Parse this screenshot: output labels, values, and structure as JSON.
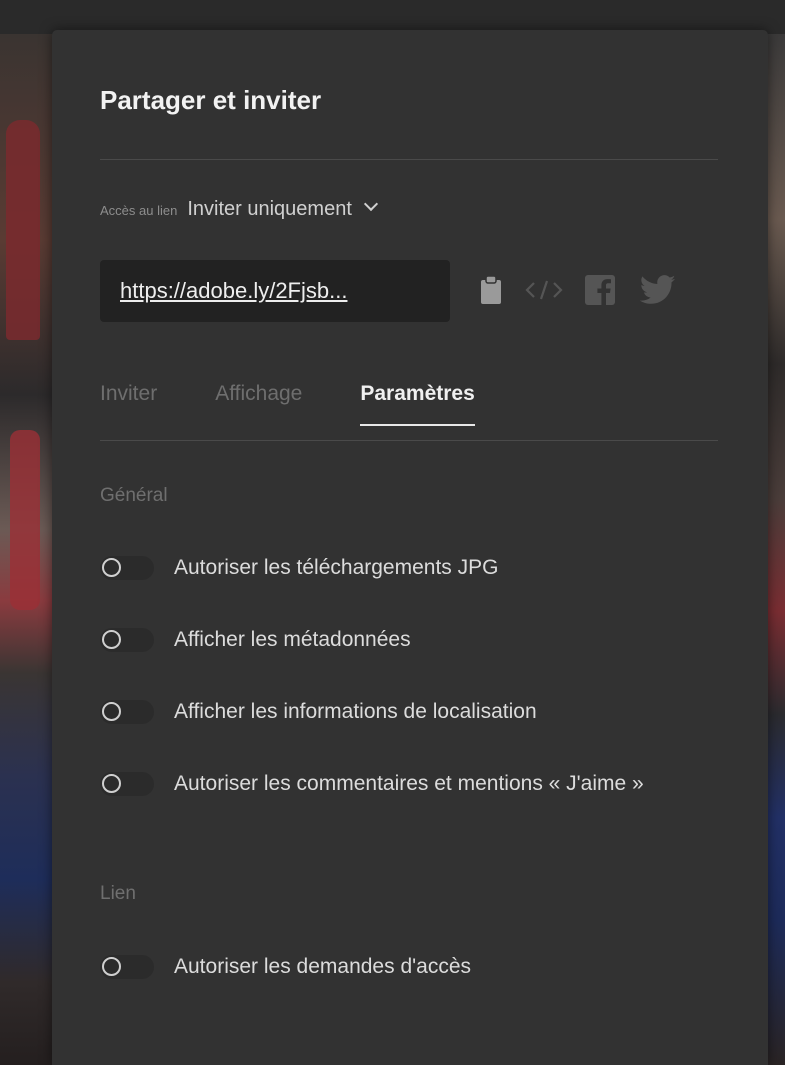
{
  "dialog": {
    "title": "Partager et inviter",
    "link_access_label": "Accès au lien",
    "link_access_value": "Inviter uniquement",
    "share_url": "https://adobe.ly/2Fjsb..."
  },
  "share_icons": [
    "clipboard-icon",
    "embed-code-icon",
    "facebook-icon",
    "twitter-icon"
  ],
  "tabs": [
    {
      "label": "Inviter",
      "active": false
    },
    {
      "label": "Affichage",
      "active": false
    },
    {
      "label": "Paramètres",
      "active": true
    }
  ],
  "settings": {
    "general_heading": "Général",
    "general_options": [
      {
        "label": "Autoriser les téléchargements JPG",
        "enabled": false
      },
      {
        "label": "Afficher les métadonnées",
        "enabled": false
      },
      {
        "label": "Afficher les informations de localisation",
        "enabled": false
      },
      {
        "label": "Autoriser les commentaires et mentions « J'aime »",
        "enabled": false
      }
    ],
    "link_heading": "Lien",
    "link_options": [
      {
        "label": "Autoriser les demandes d'accès",
        "enabled": false
      }
    ]
  }
}
